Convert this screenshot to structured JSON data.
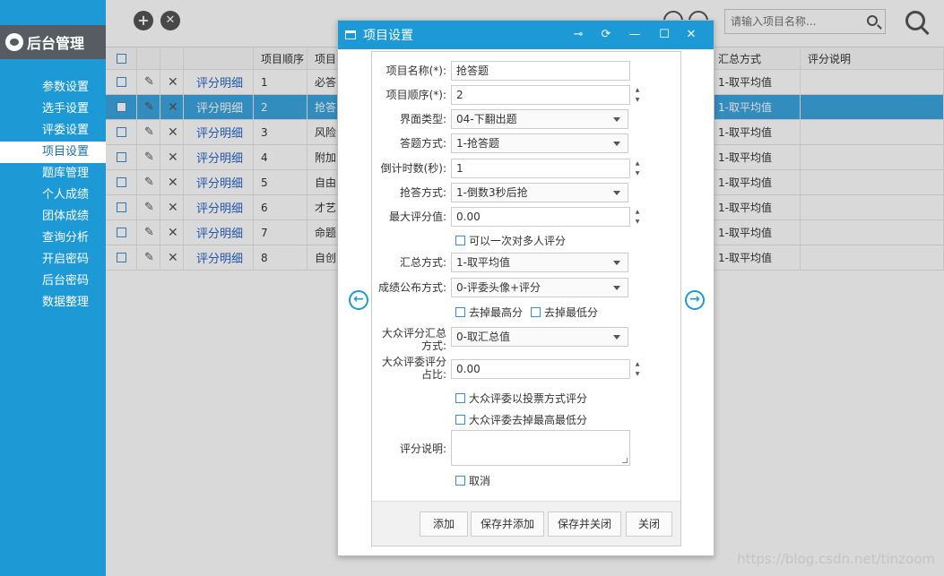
{
  "app": {
    "logo_text": "后台管理"
  },
  "sidebar": {
    "items": [
      {
        "label": "参数设置"
      },
      {
        "label": "选手设置"
      },
      {
        "label": "评委设置"
      },
      {
        "label": "项目设置"
      },
      {
        "label": "题库管理"
      },
      {
        "label": "个人成绩"
      },
      {
        "label": "团体成绩"
      },
      {
        "label": "查询分析"
      },
      {
        "label": "开启密码"
      },
      {
        "label": "后台密码"
      },
      {
        "label": "数据整理"
      }
    ],
    "active_index": 3
  },
  "toolbar": {
    "add_icon": "plus-icon",
    "delete_icon": "close-icon",
    "search_placeholder": "请输入项目名称..."
  },
  "table": {
    "columns": [
      "项目顺序",
      "项目",
      "汇总方式",
      "评分说明"
    ],
    "detail_link": "评分明细",
    "rows": [
      {
        "order": "1",
        "name": "必答",
        "summary": "1-取平均值"
      },
      {
        "order": "2",
        "name": "抢答",
        "summary": "1-取平均值"
      },
      {
        "order": "3",
        "name": "风险",
        "summary": "1-取平均值"
      },
      {
        "order": "4",
        "name": "附加",
        "summary": "1-取平均值"
      },
      {
        "order": "5",
        "name": "自由",
        "summary": "1-取平均值"
      },
      {
        "order": "6",
        "name": "才艺",
        "summary": "1-取平均值"
      },
      {
        "order": "7",
        "name": "命题",
        "summary": "1-取平均值"
      },
      {
        "order": "8",
        "name": "自创",
        "summary": "1-取平均值"
      }
    ],
    "selected_index": 1
  },
  "dialog": {
    "title": "项目设置",
    "fields": {
      "name_label": "项目名称(*):",
      "name_value": "抢答题",
      "order_label": "项目顺序(*):",
      "order_value": "2",
      "ui_type_label": "界面类型:",
      "ui_type_value": "04-下翻出题",
      "answer_mode_label": "答题方式:",
      "answer_mode_value": "1-抢答题",
      "countdown_label": "倒计时数(秒):",
      "countdown_value": "1",
      "grab_mode_label": "抢答方式:",
      "grab_mode_value": "1-倒数3秒后抢",
      "max_score_label": "最大评分值:",
      "max_score_value": "0.00",
      "multi_score_check": "可以一次对多人评分",
      "summary_label": "汇总方式:",
      "summary_value": "1-取平均值",
      "publish_label": "成绩公布方式:",
      "publish_value": "0-评委头像+评分",
      "drop_high_check": "去掉最高分",
      "drop_low_check": "去掉最低分",
      "public_summary_label": "大众评分汇总方式:",
      "public_summary_value": "0-取汇总值",
      "public_ratio_label": "大众评委评分占比:",
      "public_ratio_value": "0.00",
      "vote_check": "大众评委以投票方式评分",
      "public_drop_check": "大众评委去掉最高最低分",
      "note_label": "评分说明:",
      "cancel_check": "取消"
    },
    "buttons": {
      "add": "添加",
      "save_add": "保存并添加",
      "save_close": "保存并关闭",
      "close": "关闭"
    }
  },
  "watermark": "https://blog.csdn.net/tinzoom"
}
